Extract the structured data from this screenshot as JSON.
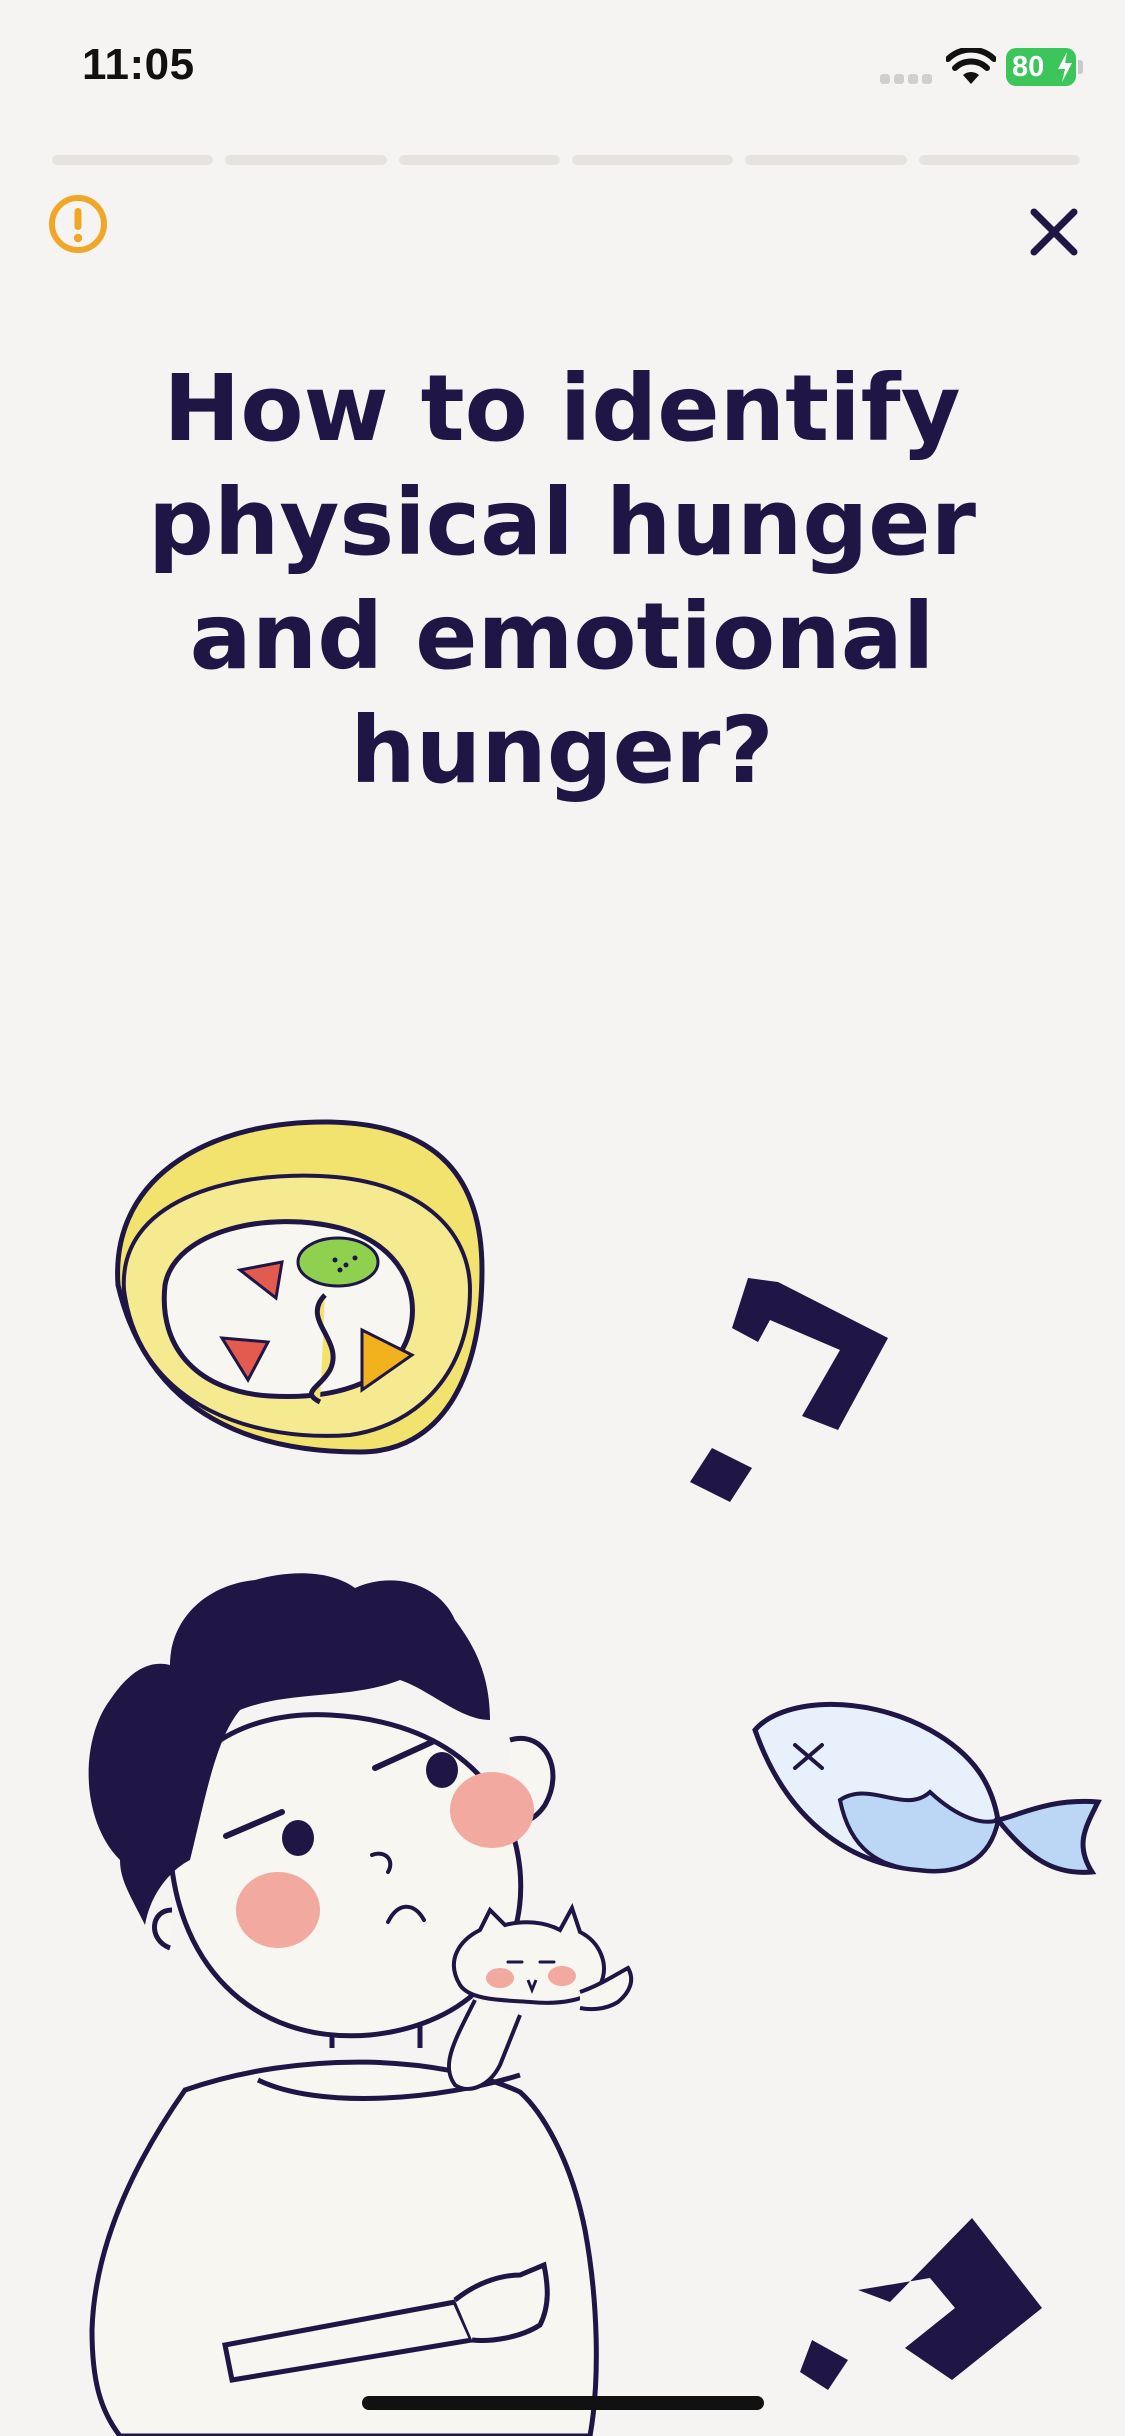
{
  "status_bar": {
    "time": "11:05",
    "battery": "80",
    "icons": [
      "signal-icon",
      "wifi-icon",
      "battery-icon",
      "charging-bolt-icon"
    ]
  },
  "story": {
    "segment_count": 6,
    "progress_color": "#e6e3df"
  },
  "header": {
    "warning_icon": "exclamation-circle-icon",
    "close_icon": "close-icon",
    "warning_color": "#f0a626",
    "close_color": "#1f1646"
  },
  "content": {
    "title": "How to identify\nphysical hunger\nand emotional\nhunger?"
  },
  "illustration": {
    "elements": [
      "swiss-roll-cake",
      "question-mark",
      "fish",
      "thinking-boy",
      "cat"
    ],
    "colors": {
      "ink": "#1f1646",
      "cake": "#f2e26e",
      "fish": "#bcd6f5",
      "blush": "#f2a9a0",
      "strawberry": "#e35b4f",
      "kiwi": "#8fd14f",
      "orange": "#f2b21d"
    }
  }
}
